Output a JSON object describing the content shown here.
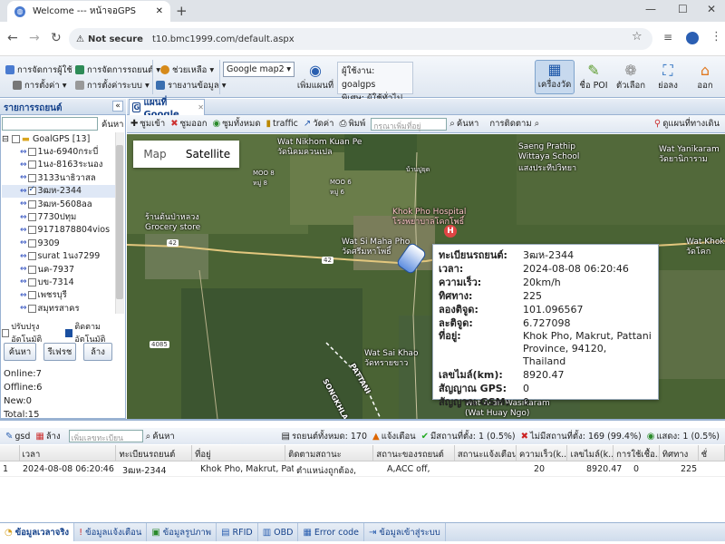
{
  "browser": {
    "tab_title": "Welcome --- หน้าจอGPS",
    "security": "Not secure",
    "url": "t10.bmc1999.com/default.aspx"
  },
  "toolbar": {
    "menu": [
      {
        "label": "การจัดการผู้ใช้",
        "icon": "users-icon"
      },
      {
        "label": "การจัดการรถยนต์",
        "icon": "car-icon"
      },
      {
        "label": "ช่วยเหลือ",
        "icon": "help-icon"
      },
      {
        "label": "การตั้งค่า",
        "icon": "gear-icon"
      },
      {
        "label": "การตั้งค่าระบบ",
        "icon": "system-gear-icon"
      },
      {
        "label": "รายงานข้อมูล",
        "icon": "report-icon"
      }
    ],
    "map_select": "Google map2",
    "add_map_label": "เพิ่มแผนที่",
    "user_label": "ผู้ใช้งาน: goalgps",
    "special_label": "พิเศษ: ผู้ใช้ทั่วไป",
    "big_buttons": [
      {
        "label": "เครื่องวัด",
        "icon": "vehicle-icon"
      },
      {
        "label": "ชื่อ POI",
        "icon": "poi-icon"
      },
      {
        "label": "ตัวเลือก",
        "icon": "options-icon"
      },
      {
        "label": "ย่อลง",
        "icon": "fullscreen-icon"
      },
      {
        "label": "ออก",
        "icon": "home-icon"
      }
    ]
  },
  "left": {
    "header": "รายการรถยนต์",
    "search_btn": "ค้นหา",
    "group": "GoalGPS [13]",
    "vehicles": [
      {
        "name": "1นง-6940กระบี่",
        "checked": false
      },
      {
        "name": "1นง-8163ระนอง",
        "checked": false
      },
      {
        "name": "3133นาธิวาสล",
        "checked": false
      },
      {
        "name": "3ฒห-2344",
        "checked": true
      },
      {
        "name": "3ฒห-5608aa",
        "checked": false
      },
      {
        "name": "7730ปทุม",
        "checked": false
      },
      {
        "name": "9171878804vios",
        "checked": false
      },
      {
        "name": "9309",
        "checked": false
      },
      {
        "name": "surat 1นง7299",
        "checked": false
      },
      {
        "name": "นค-7937",
        "checked": false
      },
      {
        "name": "บข-7314",
        "checked": false
      },
      {
        "name": "เพชรบุรี",
        "checked": false
      },
      {
        "name": "สมุทรสาคร",
        "checked": false
      }
    ],
    "opt_auto_update": "ปรับปรุงอัตโนมัติ",
    "opt_auto_follow": "ติดตามอัตโนมัติ",
    "btn_search": "ค้นหา",
    "btn_refresh": "รีเฟรช",
    "btn_clear": "ล้าง",
    "online": "Online:7",
    "offline": "Offline:6",
    "new": "New:0",
    "total": "Total:15"
  },
  "maptab": {
    "title": "แผนที่ Google",
    "zoom_in": "ซูมเข้า",
    "zoom_out": "ซูมออก",
    "zoom_all": "ซูมทั้งหมด",
    "traffic": "traffic",
    "measure": "วัดค่า",
    "print": "พิมพ์",
    "search_placeholder": "กรุณาเพิ่มที่อยู่",
    "search_btn": "ค้นหา",
    "tracking": "การติดตาม",
    "route": "ดูแผนที่ทางเดิน"
  },
  "map": {
    "type_map": "Map",
    "type_sat": "Satellite",
    "labels": [
      {
        "t": "Wat Nikhom Kuan Pe",
        "s": "วัดนิคมควนเปล"
      },
      {
        "t": "MOO 8",
        "s": "หมู่ 8"
      },
      {
        "t": "MOO 6",
        "s": "หมู่ 6"
      },
      {
        "t": "บ้านปูยุด",
        "s": ""
      },
      {
        "t": "Saeng Prathip",
        "s": "Wittaya School"
      },
      {
        "t": "แสงประทีปวิทยา",
        "s": ""
      },
      {
        "t": "Wat Yanikaram",
        "s": "วัดยานิการาม"
      },
      {
        "t": "ร้านต้นป่าหลวง",
        "s": "Grocery store"
      },
      {
        "t": "Khok Pho Hospital",
        "s": "โรงพยาบาลโคกโพธิ์"
      },
      {
        "t": "Wat Si Maha Pho",
        "s": "วัดศรีมหาโพธิ์"
      },
      {
        "t": "Wat Khok",
        "s": "วัดโคก"
      },
      {
        "t": "Wat Sai Khao",
        "s": "วัดทรายขาว"
      },
      {
        "t": "PATTANI",
        "s": ""
      },
      {
        "t": "SONGKHLA",
        "s": ""
      },
      {
        "t": "Wat Aran Wasikaram",
        "s": "(Wat Huay Ngo)"
      }
    ],
    "roads": [
      "42",
      "42",
      "4085"
    ],
    "info": [
      {
        "k": "ทะเบียนรถยนต์:",
        "v": "3ฒห-2344"
      },
      {
        "k": "เวลา:",
        "v": "2024-08-08 06:20:46"
      },
      {
        "k": "ความเร็ว:",
        "v": "20km/h"
      },
      {
        "k": "ทิศทาง:",
        "v": "225"
      },
      {
        "k": "ลองติจูด:",
        "v": "101.096567"
      },
      {
        "k": "ละติจูด:",
        "v": "6.727098"
      },
      {
        "k": "ที่อยู่:",
        "v": "Khok Pho, Makrut, Pattani Province, 94120, Thailand"
      },
      {
        "k": "เลขไมล์(km):",
        "v": "8920.47"
      },
      {
        "k": "สัญญาณ GPS:",
        "v": "0"
      },
      {
        "k": "สัญญาณ GSM:",
        "v": "0"
      }
    ]
  },
  "bottom": {
    "toolbar": {
      "gsd": "gsd",
      "clear": "ล้าง",
      "search_placeholder": "เพิ่มเลขทะเบียนรถยนต์",
      "search": "ค้นหา",
      "total": "รถยนต์ทั้งหมด: 170",
      "alerts": "แจ้งเตือน",
      "has_location": "มีสถานที่ตั้ง: 1 (0.5%)",
      "no_location": "ไม่มีสถานที่ตั้ง: 169 (99.4%)",
      "shown": "แสดง: 1 (0.5%)"
    },
    "columns": [
      "เวลา",
      "ทะเบียนรถยนต์",
      "ที่อยู่",
      "ติดตามสถานะ",
      "สถานะของรถยนต์",
      "สถานะแจ้งเตือน",
      "ความเร็ว(k...",
      "เลขไมล์(k...",
      "การใช้เชื้อ...",
      "ทิศทาง",
      "ชั่"
    ],
    "row": {
      "num": "1",
      "time": "2024-08-08 06:20:46",
      "plate": "3ฒห-2344",
      "addr": "Khok Pho, Makrut, Patt...",
      "track": "ตำแหน่งถูกต้อง,",
      "status": "A,ACC off,",
      "alert": "",
      "speed": "20",
      "mileage": "8920.47",
      "fuel": "0",
      "dir": "225"
    },
    "tabs": [
      {
        "label": "ข้อมูลเวลาจริง",
        "icon": "realtime-icon"
      },
      {
        "label": "ข้อมูลแจ้งเตือน",
        "icon": "alert-icon"
      },
      {
        "label": "ข้อมูลรูปภาพ",
        "icon": "image-icon"
      },
      {
        "label": "RFID",
        "icon": "rfid-icon"
      },
      {
        "label": "OBD",
        "icon": "obd-icon"
      },
      {
        "label": "Error code",
        "icon": "error-icon"
      },
      {
        "label": "ข้อมูลเข้าสู่ระบบ",
        "icon": "login-icon"
      }
    ]
  }
}
